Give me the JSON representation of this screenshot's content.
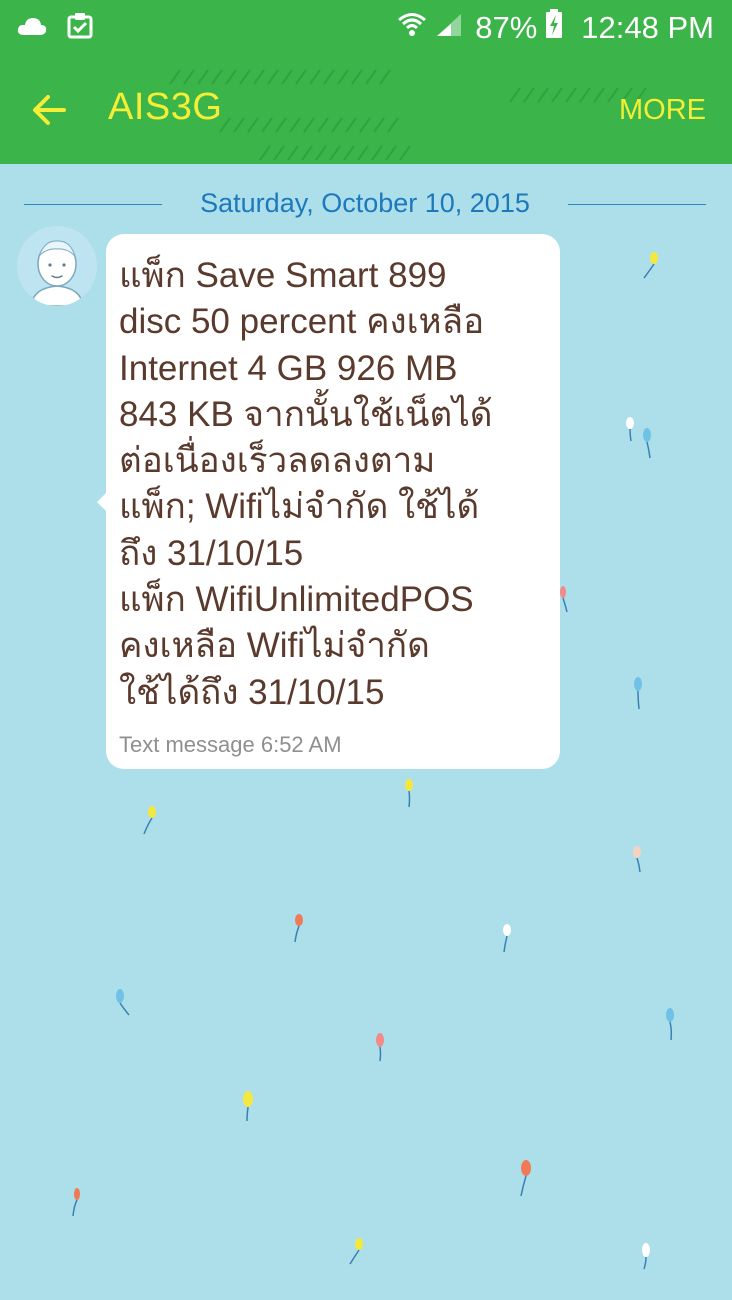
{
  "status_bar": {
    "icons_left": [
      "cloud-icon",
      "clipboard-check-icon"
    ],
    "icons_right": [
      "wifi-icon",
      "cell-signal-icon",
      "battery-charging-icon"
    ],
    "battery": "87%",
    "time": "12:48 PM"
  },
  "app_bar": {
    "title": "AIS3G",
    "more_label": "MORE",
    "back_icon": "back-arrow-icon"
  },
  "conversation": {
    "date": "Saturday, October 10, 2015",
    "messages": [
      {
        "text": "แพ็ก Save Smart 899\ndisc 50 percent คงเหลือ\nInternet 4 GB 926 MB\n843 KB จากนั้นใช้เน็ตได้\nต่อเนื่องเร็วลดลงตาม\nแพ็ก; Wifiไม่จำกัด ใช้ได้\nถึง 31/10/15\nแพ็ก WifiUnlimitedPOS\nคงเหลือ Wifiไม่จำกัด\nใช้ได้ถึง 31/10/15",
        "meta": "Text message 6:52 AM"
      }
    ]
  },
  "colors": {
    "header_green": "#3bb449",
    "header_text_yellow": "#f5ee37",
    "background_blue": "#acdfea",
    "date_blue": "#1e78bc",
    "message_text_brown": "#5a3a2d"
  }
}
